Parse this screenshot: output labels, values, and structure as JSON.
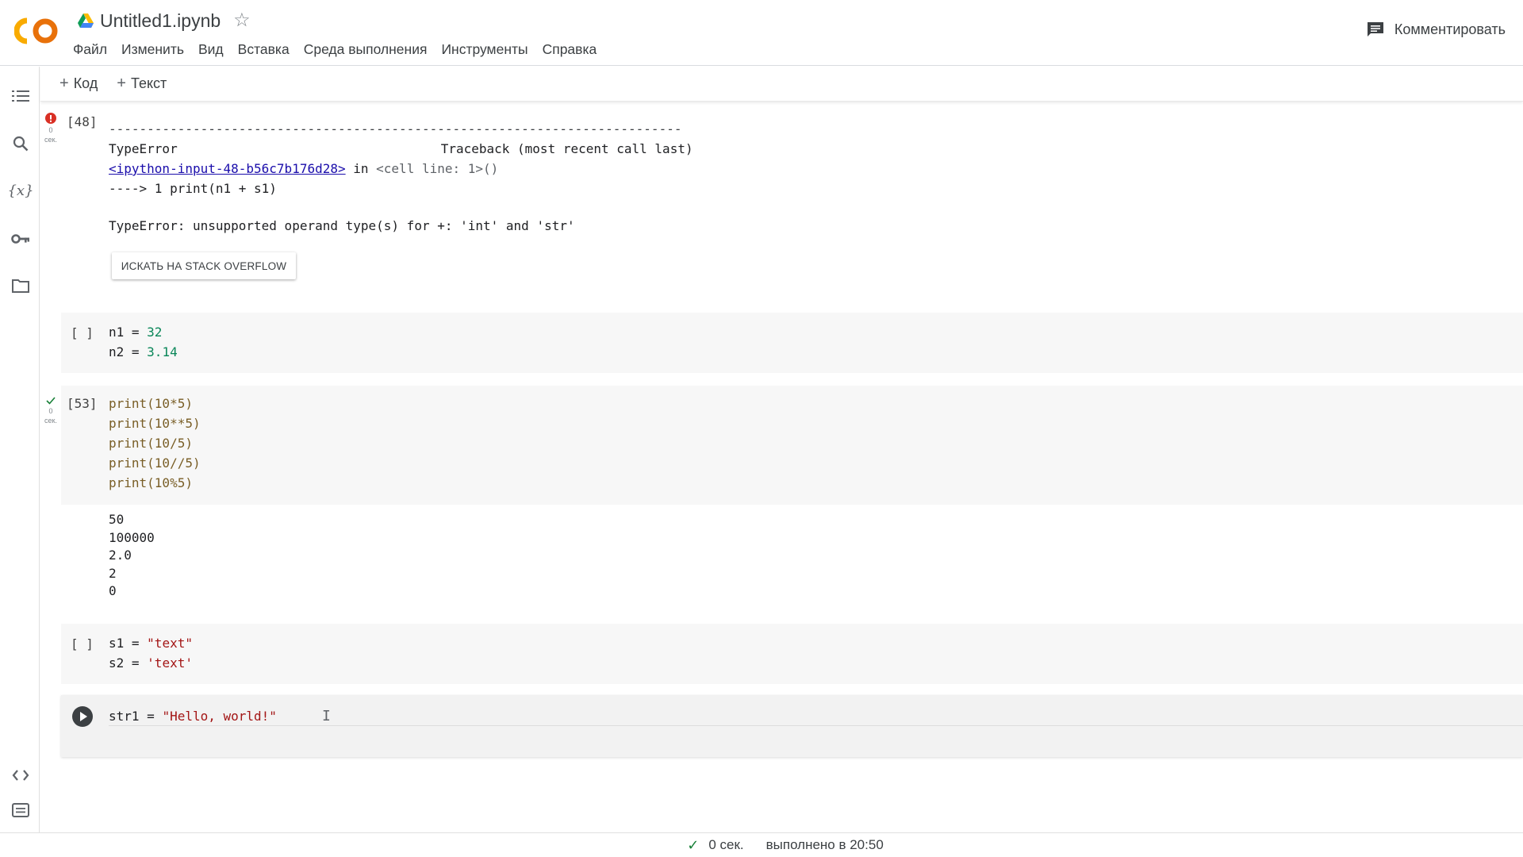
{
  "app": {
    "logo_text": "CO",
    "doc_title": "Untitled1.ipynb",
    "menu": [
      "Файл",
      "Изменить",
      "Вид",
      "Вставка",
      "Среда выполнения",
      "Инструменты",
      "Справка"
    ],
    "comment_label": "Комментировать"
  },
  "toolbar": {
    "add_code": "Код",
    "add_text": "Текст",
    "plus": "+"
  },
  "sidebar": {
    "icons": [
      "toc-icon",
      "search-icon",
      "variables-icon",
      "key-icon",
      "folder-icon",
      "code-snippets-icon",
      "terminal-icon"
    ],
    "variables_label": "{x}"
  },
  "cells": {
    "error_cell": {
      "exec_count": "[48]",
      "status_num": "0",
      "status_unit": "сек.",
      "dashes": "---------------------------------------------------------------------------",
      "err_name": "TypeError",
      "traceback_label": "Traceback (most recent call last)",
      "link_text": "<ipython-input-48-b56c7b176d28>",
      "in_word": " in ",
      "cell_line": "<cell line: 1>()",
      "arrow_prefix": "----> 1 ",
      "arrow_code": "print(n1 + s1)",
      "error_message": "TypeError: unsupported operand type(s) for +: 'int' and 'str'",
      "so_button": "ИСКАТЬ НА STACK OVERFLOW"
    },
    "cell_vars": {
      "exec_count": "[ ]",
      "line1_var": "n1",
      "line1_val": "32",
      "line2_var": "n2",
      "line2_val": "3.14",
      "eq": " = "
    },
    "cell_ops": {
      "exec_count": "[53]",
      "status_num": "0",
      "status_unit": "сек.",
      "lines": [
        "print(10*5)",
        "print(10**5)",
        "print(10/5)",
        "print(10//5)",
        "print(10%5)"
      ],
      "outputs": [
        "50",
        "100000",
        "2.0",
        "2",
        "0"
      ]
    },
    "cell_strings": {
      "exec_count": "[ ]",
      "line1_var": "s1",
      "line1_val": "\"text\"",
      "line2_var": "s2",
      "line2_val": "'text'",
      "eq": " = "
    },
    "cell_active": {
      "var": "str1",
      "eq": " = ",
      "val": "\"Hello, world!\""
    }
  },
  "footer": {
    "time": "0 сек.",
    "done": "выполнено в 20:50"
  },
  "colors": {
    "logo_orange": "#f9ab00",
    "error_red": "#d93025",
    "success_green": "#188038",
    "link_blue": "#1a0dab",
    "number_green": "#098658",
    "string_red": "#a31515"
  }
}
